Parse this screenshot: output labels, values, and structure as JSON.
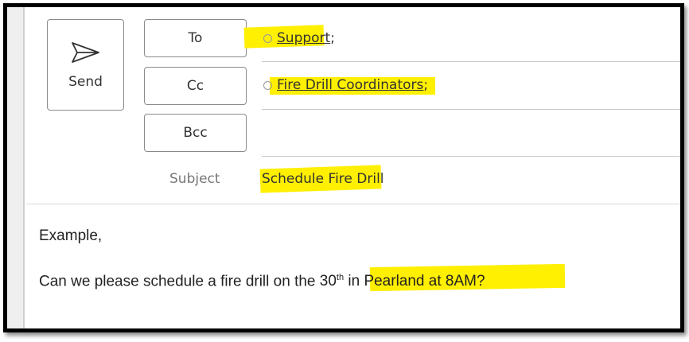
{
  "compose": {
    "send_label": "Send",
    "to_label": "To",
    "cc_label": "Cc",
    "bcc_label": "Bcc",
    "to_recipients": [
      {
        "name": "Support",
        "separator": ";"
      }
    ],
    "cc_recipients": [
      {
        "name": "Fire Drill Coordinators",
        "separator": ";"
      }
    ],
    "bcc_recipients": [],
    "subject_label": "Subject",
    "subject_value": "Schedule Fire Drill"
  },
  "body": {
    "line1": "Example,",
    "line2_pre": "Can we please schedule a fire drill on the ",
    "line2_day": "30",
    "line2_suffix": "th",
    "line2_post": " in Pearland at 8AM?"
  },
  "colors": {
    "highlight": "#ffef00",
    "frame_border": "#000000",
    "button_border": "#8a8a8a"
  },
  "icons": {
    "send": "send-icon (paper plane)",
    "presence": "presence-circle-icon"
  }
}
